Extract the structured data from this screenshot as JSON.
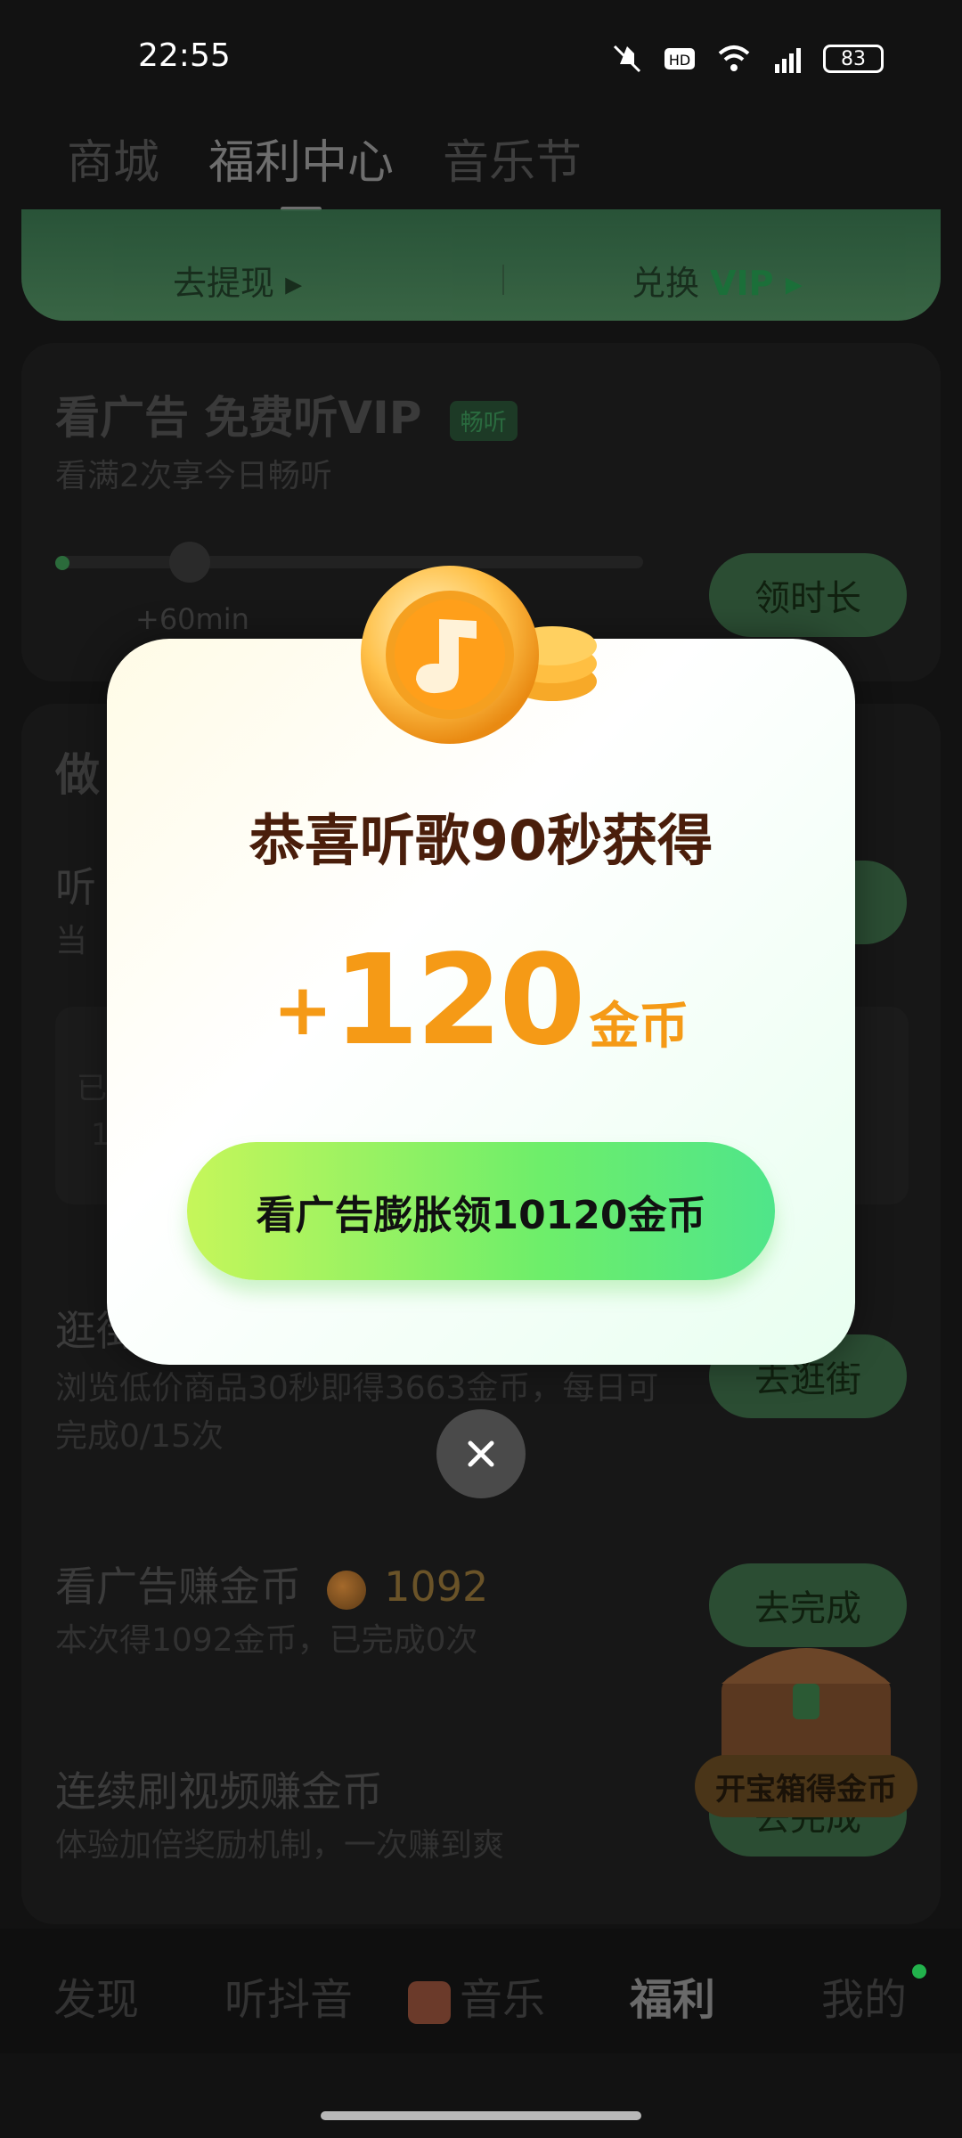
{
  "status_bar": {
    "time": "22:55",
    "battery": "83"
  },
  "top_tabs": [
    {
      "label": "商城"
    },
    {
      "label": "福利中心"
    },
    {
      "label": "音乐节"
    }
  ],
  "banner": {
    "withdraw_label": "去提现 ▸",
    "exchange_label": "兑换",
    "exchange_vip": "VIP ▸"
  },
  "ad_card": {
    "title": "看广告 免费听VIP",
    "tag": "畅听",
    "subtitle": "看满2次享今日畅听",
    "milestone": "+60min",
    "button": "领时长"
  },
  "tasks_card": {
    "section_title": "做",
    "listen_title": "听",
    "listen_sub": "当",
    "box_line1": "已",
    "box_line2": "1"
  },
  "shopping_task": {
    "title": "逛街",
    "subtitle": "浏览低价商品30秒即得3663金币，每日可完成0/15次",
    "button": "去逛街"
  },
  "ad_task": {
    "title": "看广告赚金币",
    "coins": "1092",
    "subtitle": "本次得1092金币，已完成0次",
    "button": "去完成"
  },
  "video_task": {
    "title": "连续刷视频赚金币",
    "subtitle": "体验加倍奖励机制，一次赚到爽",
    "button": "去完成"
  },
  "chest": {
    "label": "开宝箱得金币"
  },
  "bottom_nav": [
    {
      "label": "发现"
    },
    {
      "label": "听抖音"
    },
    {
      "label": "音乐"
    },
    {
      "label": "福利"
    },
    {
      "label": "我的"
    }
  ],
  "modal": {
    "title": "恭喜听歌90秒获得",
    "plus": "+",
    "amount": "120",
    "unit": "金币",
    "cta": "看广告膨胀领10120金币"
  },
  "colors": {
    "accent_green": "#4fe58a",
    "reward_orange": "#f59a16",
    "title_brown": "#4a1e0b"
  }
}
